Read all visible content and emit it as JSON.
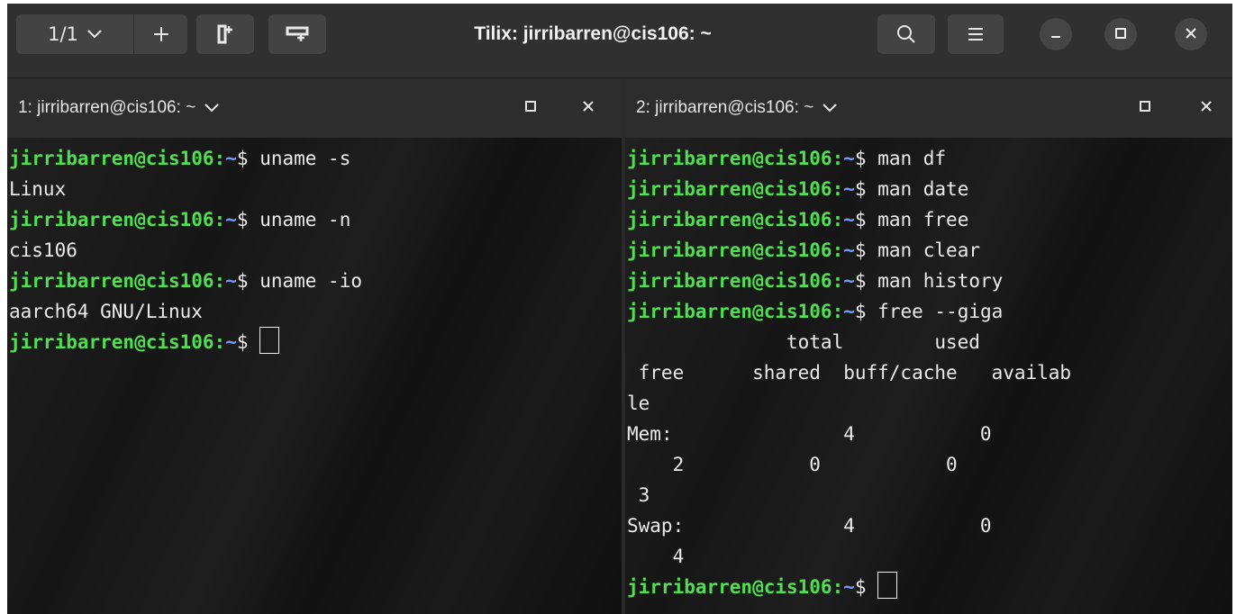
{
  "header": {
    "session_label": "1/1",
    "title": "Tilix: jirribarren@cis106: ~"
  },
  "icons": {
    "session_dropdown": "chevron-down-icon",
    "add_session": "plus-icon",
    "split_right": "split-terminal-icon",
    "split_down": "split-down-icon",
    "search": "search-icon",
    "menu": "hamburger-menu-icon",
    "minimize": "minimize-icon",
    "maximize": "maximize-icon",
    "close": "close-icon"
  },
  "colors": {
    "prompt_user": "#4fe04f",
    "prompt_path": "#6f9cff",
    "terminal_text": "#ececec",
    "headerbar": "#303030"
  },
  "left_pane": {
    "title": "1: jirribarren@cis106: ~",
    "prompt": {
      "user": "jirribarren@cis106",
      "sep": ":",
      "path": "~",
      "sigil": "$ "
    },
    "lines": [
      {
        "type": "prompt",
        "command": "uname -s"
      },
      {
        "type": "output",
        "text": "Linux"
      },
      {
        "type": "prompt",
        "command": "uname -n"
      },
      {
        "type": "output",
        "text": "cis106"
      },
      {
        "type": "prompt",
        "command": "uname -io"
      },
      {
        "type": "output",
        "text": "aarch64 GNU/Linux"
      },
      {
        "type": "prompt",
        "command": "",
        "cursor": true
      }
    ]
  },
  "right_pane": {
    "title": "2: jirribarren@cis106: ~",
    "prompt": {
      "user": "jirribarren@cis106",
      "sep": ":",
      "path": "~",
      "sigil": "$ "
    },
    "lines": [
      {
        "type": "prompt",
        "command": "man df"
      },
      {
        "type": "prompt",
        "command": "man date"
      },
      {
        "type": "prompt",
        "command": "man free"
      },
      {
        "type": "prompt",
        "command": "man clear"
      },
      {
        "type": "prompt",
        "command": "man history"
      },
      {
        "type": "prompt",
        "command": "free --giga"
      },
      {
        "type": "output",
        "text": "              total        used"
      },
      {
        "type": "output",
        "text": " free      shared  buff/cache   availab"
      },
      {
        "type": "output",
        "text": "le"
      },
      {
        "type": "output",
        "text": "Mem:               4           0"
      },
      {
        "type": "output",
        "text": "    2           0           0"
      },
      {
        "type": "output",
        "text": " 3"
      },
      {
        "type": "output",
        "text": "Swap:              4           0"
      },
      {
        "type": "output",
        "text": "    4"
      },
      {
        "type": "prompt",
        "command": "",
        "cursor": true
      }
    ]
  }
}
